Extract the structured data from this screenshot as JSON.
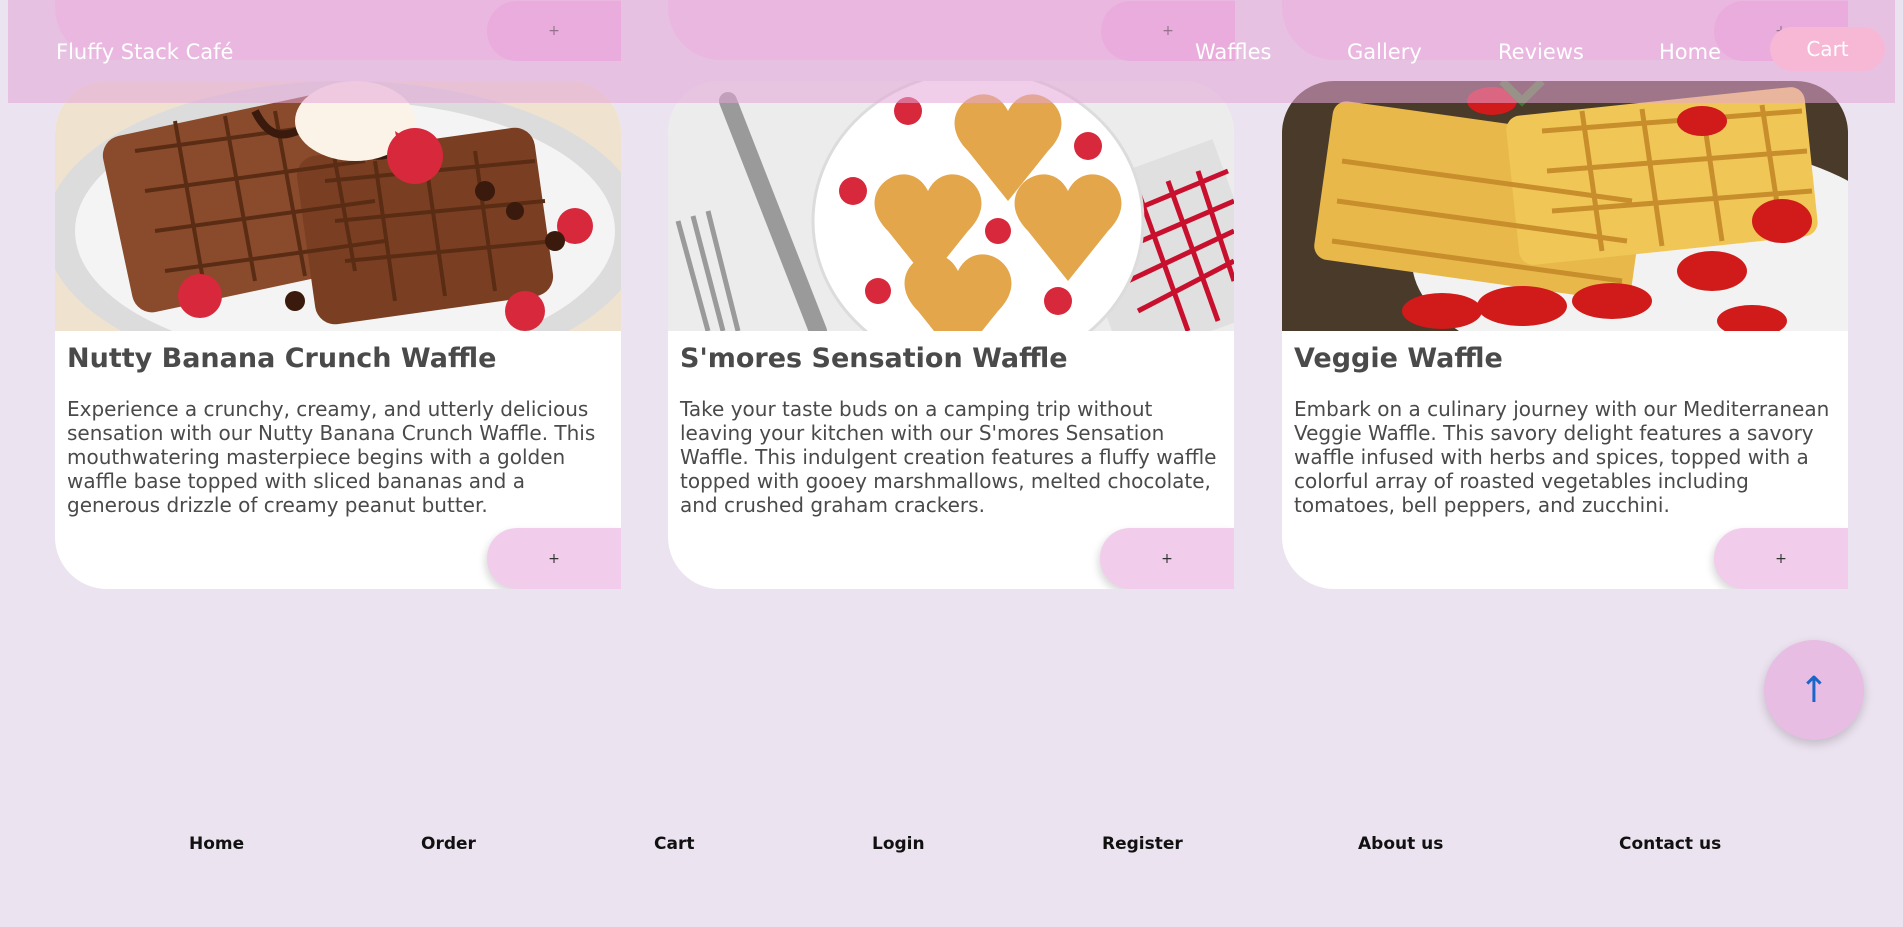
{
  "brand": "Fluffy Stack Café",
  "nav": {
    "items": [
      "Waffles",
      "Gallery",
      "Reviews",
      "Home"
    ],
    "cart_label": "Cart"
  },
  "top_row": {
    "add_label": "+"
  },
  "cards": [
    {
      "title": "Nutty Banana Crunch Waffle",
      "description": "Experience a crunchy, creamy, and utterly delicious sensation with our Nutty Banana Crunch Waffle. This mouthwatering masterpiece begins with a golden waffle base topped with sliced bananas and a generous drizzle of creamy peanut butter.",
      "add_label": "+"
    },
    {
      "title": "S'mores Sensation Waffle",
      "description": "Take your taste buds on a camping trip without leaving your kitchen with our S'mores Sensation Waffle. This indulgent creation features a fluffy waffle topped with gooey marshmallows, melted chocolate, and crushed graham crackers.",
      "add_label": "+"
    },
    {
      "title": "Veggie Waffle",
      "description": "Embark on a culinary journey with our Mediterranean Veggie Waffle. This savory delight features a savory waffle infused with herbs and spices, topped with a colorful array of roasted vegetables including tomatoes, bell peppers, and zucchini.",
      "add_label": "+"
    }
  ],
  "scroll_top_label": "↑",
  "footer": {
    "links": [
      "Home",
      "Order",
      "Cart",
      "Login",
      "Register",
      "About us",
      "Contact us"
    ]
  },
  "colors": {
    "background": "#ece3f0",
    "header": "#e4a6d7",
    "card_button": "#f2cdeb",
    "cart_button": "#f7b8d6",
    "scroll_arrow": "#1a66c8"
  },
  "icons": [
    "scroll-top-arrow-icon"
  ]
}
